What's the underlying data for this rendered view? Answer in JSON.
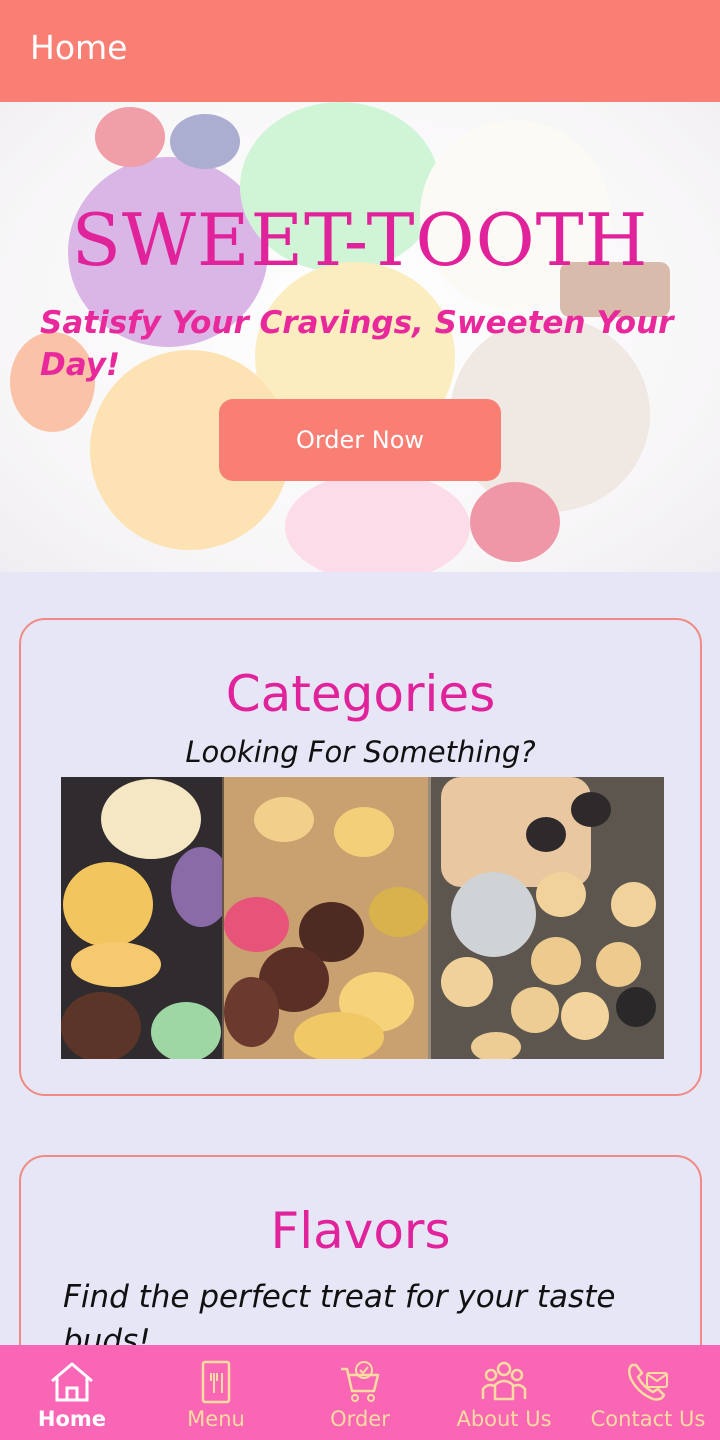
{
  "appbar": {
    "title": "Home"
  },
  "hero": {
    "brand": "SWEET-TOOTH",
    "tagline": "Satisfy Your Cravings, Sweeten Your Day!",
    "cta_label": "Order Now"
  },
  "categories": {
    "title": "Categories",
    "subtitle": "Looking For Something?",
    "images": [
      "ice-cream-image",
      "pastries-image",
      "cake-pops-image"
    ]
  },
  "flavors": {
    "title": "Flavors",
    "subtitle": "Find the perfect treat for your taste buds!"
  },
  "bottom_nav": {
    "items": [
      {
        "label": "Home",
        "icon": "home-icon",
        "active": true
      },
      {
        "label": "Menu",
        "icon": "menu-icon",
        "active": false
      },
      {
        "label": "Order",
        "icon": "cart-icon",
        "active": false
      },
      {
        "label": "About Us",
        "icon": "people-icon",
        "active": false
      },
      {
        "label": "Contact Us",
        "icon": "contact-icon",
        "active": false
      }
    ]
  },
  "colors": {
    "appbar": "#f97f74",
    "accent_pink": "#e0239a",
    "bottom_nav": "#f966b5",
    "nav_label": "#fcdca0",
    "background": "#e6e6f7"
  }
}
